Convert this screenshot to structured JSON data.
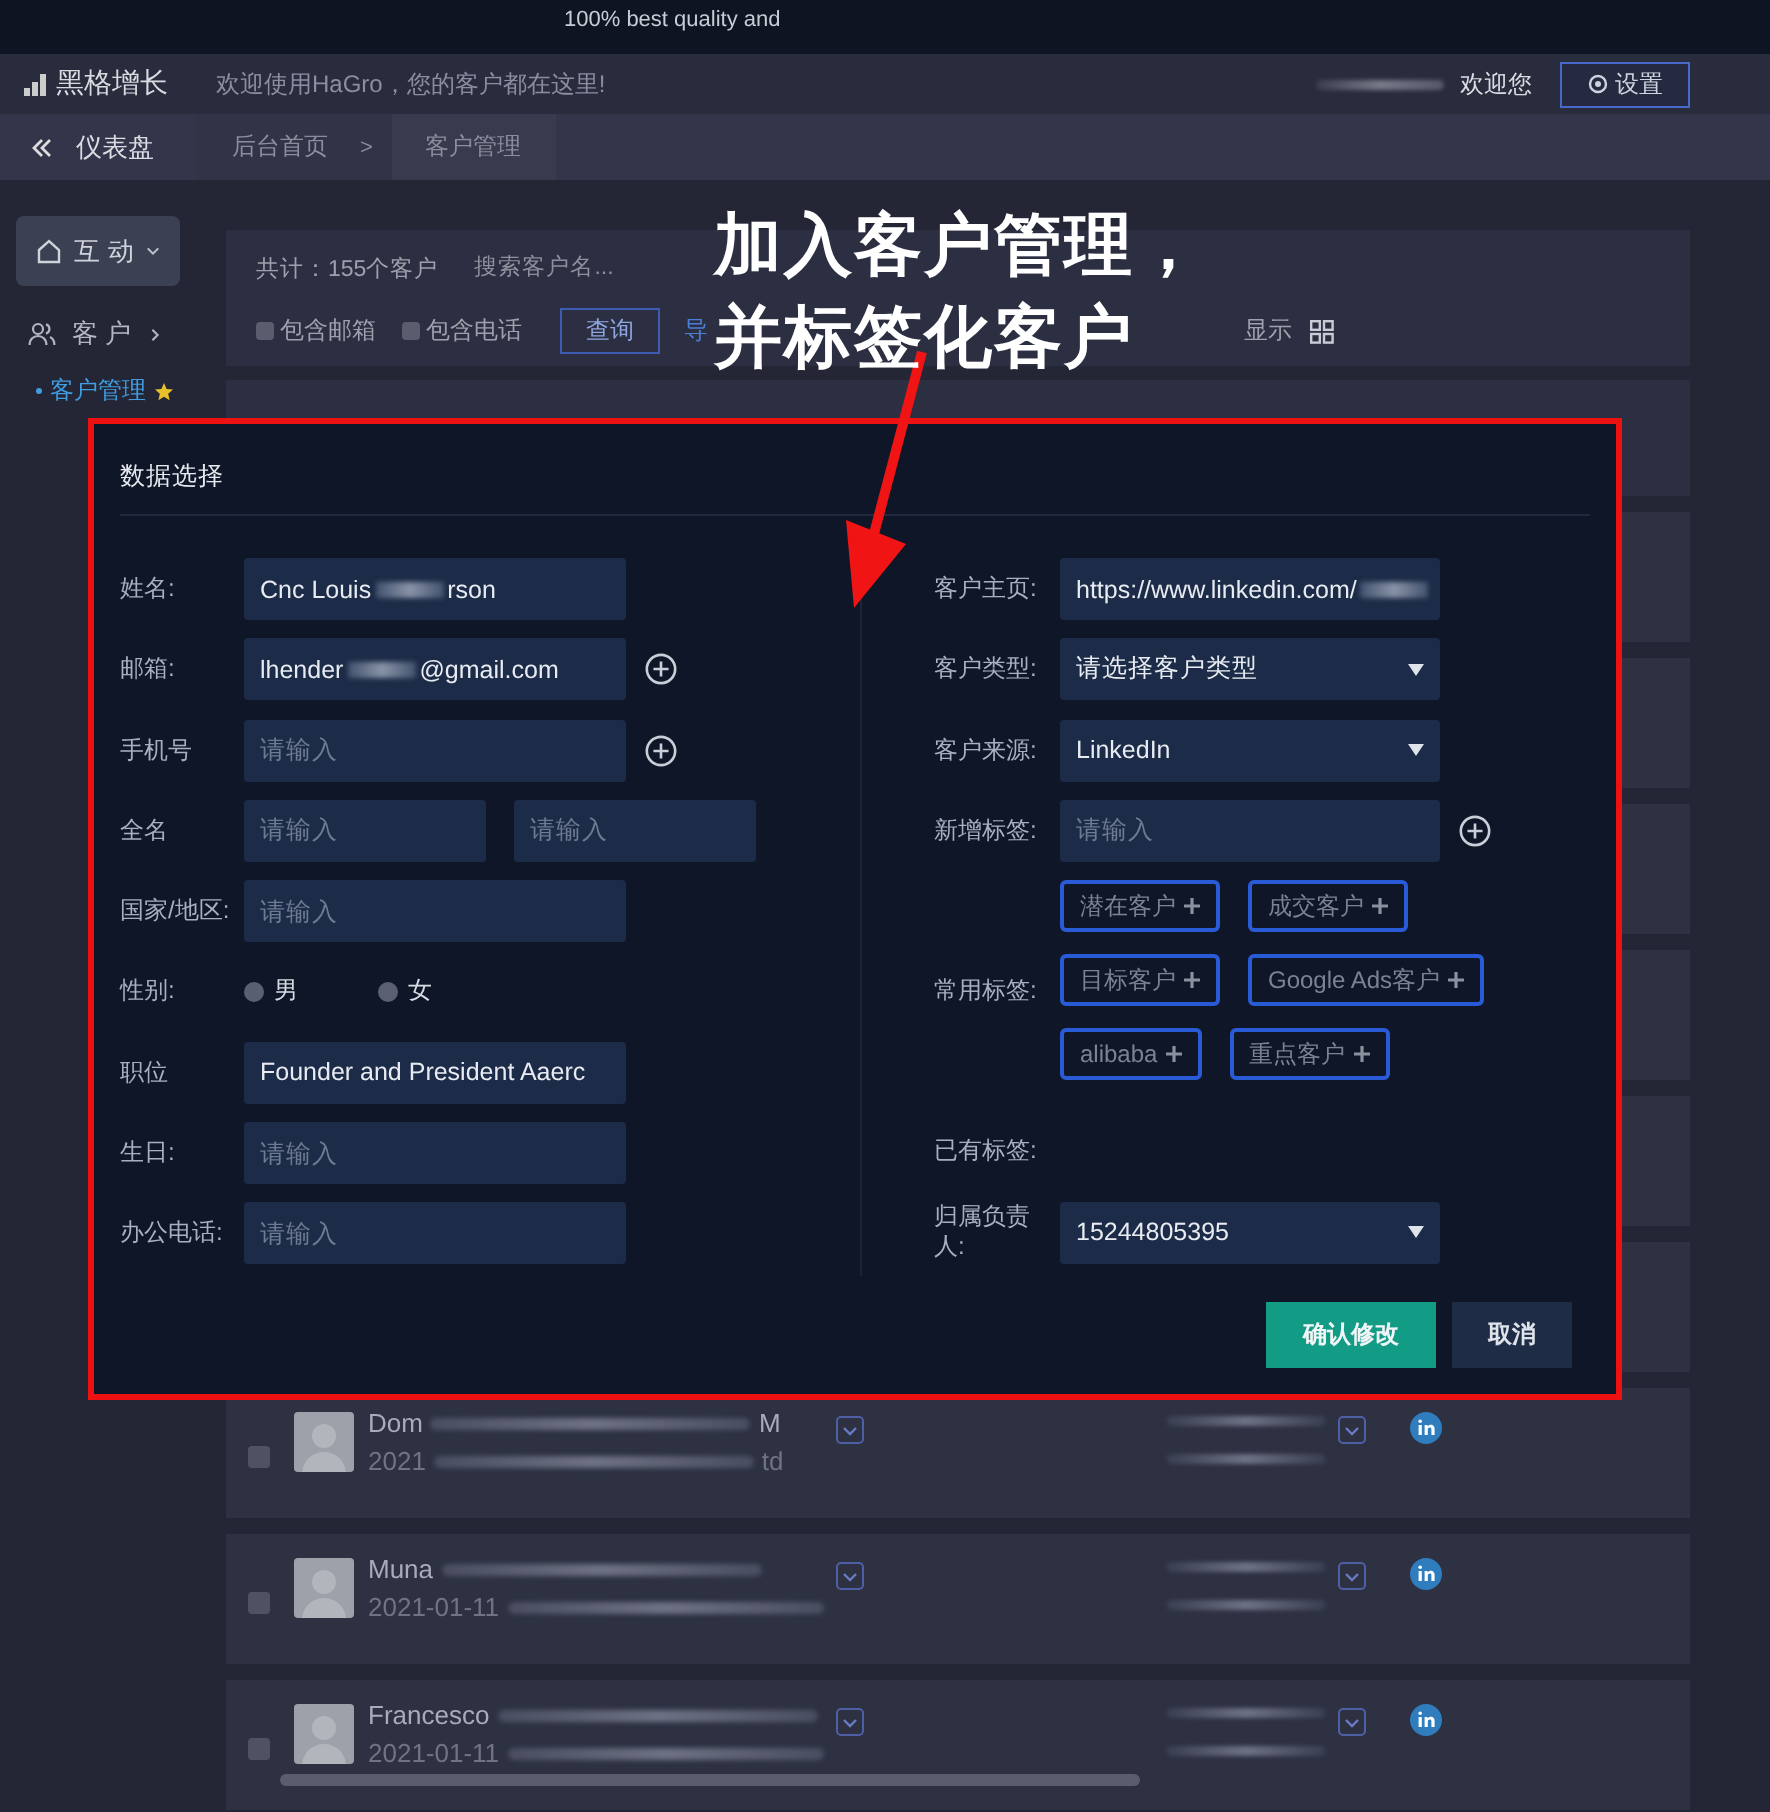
{
  "top_strip": {
    "text": "100% best quality and"
  },
  "header": {
    "app_name": "黑格增长",
    "tagline": "欢迎使用HaGro，您的客户都在这里!",
    "greeting": "欢迎您",
    "settings_button": "设置"
  },
  "breadcrumb": {
    "home": "仪表盘",
    "tabs": [
      {
        "label": "后台首页"
      },
      {
        "label": "客户管理"
      }
    ],
    "separator": ">"
  },
  "sidebar": [
    {
      "kind": "button",
      "label": "互 动",
      "expanded": true
    },
    {
      "kind": "group",
      "label": "客 户",
      "expanded": false
    },
    {
      "kind": "link",
      "label": "客户管理",
      "starred": true
    }
  ],
  "filters": {
    "total": "共计：155个客户",
    "search_placeholder": "搜索客户名...",
    "checkboxes": [
      {
        "label": "包含邮箱",
        "checked": false
      },
      {
        "label": "包含电话",
        "checked": false
      }
    ],
    "query_button": "查询",
    "export_link": "导",
    "display_label": "显示"
  },
  "rows": [
    {
      "name": "Dom",
      "name_end": "M",
      "date": "2021",
      "date_end": "td",
      "checked": false
    },
    {
      "name": "Muna",
      "date": "2021-01-11",
      "checked": false
    },
    {
      "name": "Francesco",
      "date": "2021-01-11",
      "checked": false
    }
  ],
  "dialog": {
    "title": "数据选择",
    "left_fields": [
      {
        "kind": "input",
        "label": "姓名:",
        "value": "Cnc Louis",
        "value_end": "rson",
        "blurred": true
      },
      {
        "kind": "input_add",
        "label": "邮箱:",
        "value": "lhender",
        "value_end": "@gmail.com",
        "blurred": true
      },
      {
        "kind": "input_add",
        "label": "手机号",
        "placeholder": "请输入"
      },
      {
        "kind": "pair",
        "label": "全名",
        "placeholders": [
          "请输入",
          "请输入"
        ]
      },
      {
        "kind": "input",
        "label": "国家/地区:",
        "placeholder": "请输入"
      },
      {
        "kind": "radio",
        "label": "性别:",
        "options": [
          {
            "label": "男",
            "selected": false
          },
          {
            "label": "女",
            "selected": false
          }
        ]
      },
      {
        "kind": "input",
        "label": "职位",
        "value": "Founder and President Aaerc"
      },
      {
        "kind": "input",
        "label": "生日:",
        "placeholder": "请输入"
      },
      {
        "kind": "input",
        "label": "办公电话:",
        "placeholder": "请输入"
      }
    ],
    "right_fields": [
      {
        "kind": "input",
        "label": "客户主页:",
        "value": "https://www.linkedin.com/",
        "blurred": true
      },
      {
        "kind": "select",
        "label": "客户类型:",
        "value": "请选择客户类型"
      },
      {
        "kind": "select",
        "label": "客户来源:",
        "value": "LinkedIn"
      },
      {
        "kind": "input_add",
        "label": "新增标签:",
        "placeholder": "请输入"
      },
      {
        "kind": "tags",
        "label": "常用标签:",
        "tags": [
          "潜在客户",
          "成交客户",
          "目标客户",
          "Google Ads客户",
          "alibaba",
          "重点客户"
        ]
      },
      {
        "kind": "empty",
        "label": "已有标签:"
      },
      {
        "kind": "select",
        "label": "归属负责人:",
        "value": "15244805395"
      }
    ],
    "confirm_button": "确认修改",
    "cancel_button": "取消"
  },
  "annotation": {
    "lines": [
      "加入客户管理，",
      "并标签化客户"
    ]
  }
}
